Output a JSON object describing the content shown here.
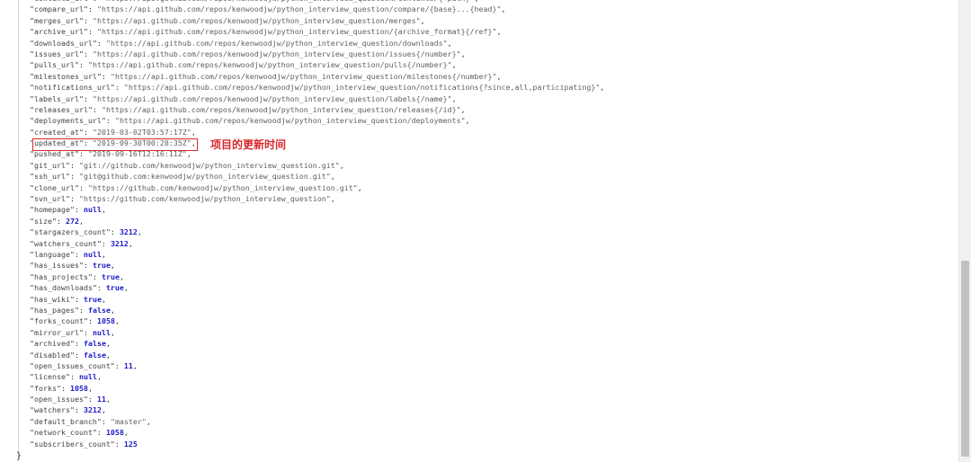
{
  "json_lines": [
    {
      "key": "contents_url",
      "value": "https://api.github.com/repos/kenwoodjw/python_interview_question/contents/{+path}",
      "type": "string"
    },
    {
      "key": "compare_url",
      "value": "https://api.github.com/repos/kenwoodjw/python_interview_question/compare/{base}...{head}",
      "type": "string"
    },
    {
      "key": "merges_url",
      "value": "https://api.github.com/repos/kenwoodjw/python_interview_question/merges",
      "type": "string"
    },
    {
      "key": "archive_url",
      "value": "https://api.github.com/repos/kenwoodjw/python_interview_question/{archive_format}{/ref}",
      "type": "string"
    },
    {
      "key": "downloads_url",
      "value": "https://api.github.com/repos/kenwoodjw/python_interview_question/downloads",
      "type": "string"
    },
    {
      "key": "issues_url",
      "value": "https://api.github.com/repos/kenwoodjw/python_interview_question/issues{/number}",
      "type": "string"
    },
    {
      "key": "pulls_url",
      "value": "https://api.github.com/repos/kenwoodjw/python_interview_question/pulls{/number}",
      "type": "string"
    },
    {
      "key": "milestones_url",
      "value": "https://api.github.com/repos/kenwoodjw/python_interview_question/milestones{/number}",
      "type": "string"
    },
    {
      "key": "notifications_url",
      "value": "https://api.github.com/repos/kenwoodjw/python_interview_question/notifications{?since,all,participating}",
      "type": "string"
    },
    {
      "key": "labels_url",
      "value": "https://api.github.com/repos/kenwoodjw/python_interview_question/labels{/name}",
      "type": "string"
    },
    {
      "key": "releases_url",
      "value": "https://api.github.com/repos/kenwoodjw/python_interview_question/releases{/id}",
      "type": "string"
    },
    {
      "key": "deployments_url",
      "value": "https://api.github.com/repos/kenwoodjw/python_interview_question/deployments",
      "type": "string"
    },
    {
      "key": "created_at",
      "value": "2019-03-02T03:57:17Z",
      "type": "string"
    },
    {
      "key": "updated_at",
      "value": "2019-09-30T00:28:35Z",
      "type": "string"
    },
    {
      "key": "pushed_at",
      "value": "2019-09-16T12:16:11Z",
      "type": "string"
    },
    {
      "key": "git_url",
      "value": "git://github.com/kenwoodjw/python_interview_question.git",
      "type": "string"
    },
    {
      "key": "ssh_url",
      "value": "git@github.com:kenwoodjw/python_interview_question.git",
      "type": "string"
    },
    {
      "key": "clone_url",
      "value": "https://github.com/kenwoodjw/python_interview_question.git",
      "type": "string"
    },
    {
      "key": "svn_url",
      "value": "https://github.com/kenwoodjw/python_interview_question",
      "type": "string"
    },
    {
      "key": "homepage",
      "value": "null",
      "type": "literal"
    },
    {
      "key": "size",
      "value": "272",
      "type": "literal"
    },
    {
      "key": "stargazers_count",
      "value": "3212",
      "type": "literal"
    },
    {
      "key": "watchers_count",
      "value": "3212",
      "type": "literal"
    },
    {
      "key": "language",
      "value": "null",
      "type": "literal"
    },
    {
      "key": "has_issues",
      "value": "true",
      "type": "literal"
    },
    {
      "key": "has_projects",
      "value": "true",
      "type": "literal"
    },
    {
      "key": "has_downloads",
      "value": "true",
      "type": "literal"
    },
    {
      "key": "has_wiki",
      "value": "true",
      "type": "literal"
    },
    {
      "key": "has_pages",
      "value": "false",
      "type": "literal"
    },
    {
      "key": "forks_count",
      "value": "1058",
      "type": "literal"
    },
    {
      "key": "mirror_url",
      "value": "null",
      "type": "literal"
    },
    {
      "key": "archived",
      "value": "false",
      "type": "literal"
    },
    {
      "key": "disabled",
      "value": "false",
      "type": "literal"
    },
    {
      "key": "open_issues_count",
      "value": "11",
      "type": "literal"
    },
    {
      "key": "license",
      "value": "null",
      "type": "literal"
    },
    {
      "key": "forks",
      "value": "1058",
      "type": "literal"
    },
    {
      "key": "open_issues",
      "value": "11",
      "type": "literal"
    },
    {
      "key": "watchers",
      "value": "3212",
      "type": "literal"
    },
    {
      "key": "default_branch",
      "value": "master",
      "type": "string"
    },
    {
      "key": "network_count",
      "value": "1058",
      "type": "literal"
    },
    {
      "key": "subscribers_count",
      "value": "125",
      "type": "literal",
      "last": true
    }
  ],
  "closing_brace": "}",
  "annotation": {
    "text": "项目的更新时间",
    "color": "#d8282b"
  },
  "colors": {
    "literal": "#1c1cc9",
    "string": "#606060",
    "highlight": "#d8282b"
  }
}
